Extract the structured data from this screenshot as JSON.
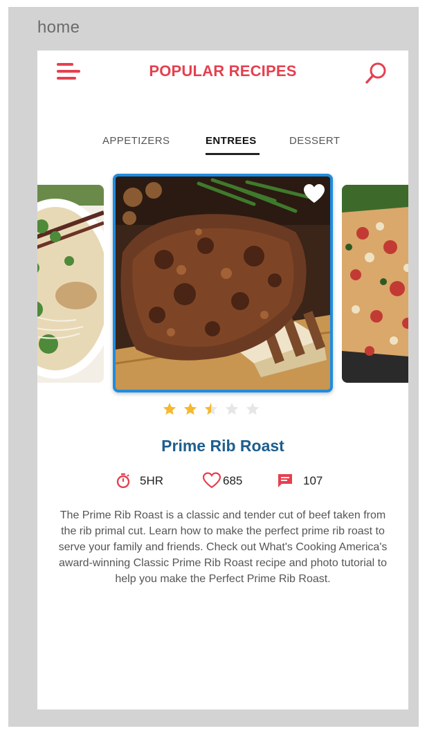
{
  "frame_label": "home",
  "header": {
    "title": "POPULAR RECIPES",
    "menu_icon": "hamburger-menu-icon",
    "search_icon": "search-icon"
  },
  "tabs": [
    {
      "label": "APPETIZERS",
      "active": false
    },
    {
      "label": "ENTREES",
      "active": true
    },
    {
      "label": "DESSERT",
      "active": false
    }
  ],
  "featured": {
    "title": "Prime Rib Roast",
    "rating": 2.5,
    "rating_max": 5,
    "favorite": true,
    "time": "5HR",
    "likes": "685",
    "comments": "107",
    "description": "The Prime Rib Roast is a classic and tender cut of beef taken from the rib primal cut.  Learn how to make the perfect prime rib roast to serve your family and friends.  Check out What's Cooking America's award-winning Classic Prime Rib Roast recipe and photo tutorial to help you make the Perfect Prime Rib Roast."
  },
  "colors": {
    "accent": "#e5404f",
    "title_blue": "#1e5e8e",
    "card_border": "#1e8ce0",
    "star_on": "#f5b82e",
    "star_off": "#e6e6e6"
  }
}
